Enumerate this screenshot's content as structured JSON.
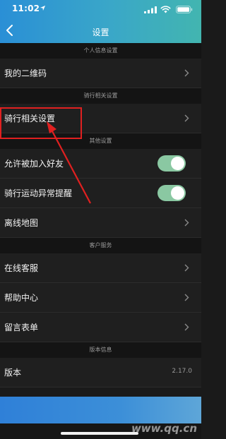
{
  "status_bar": {
    "time": "11:02"
  },
  "nav": {
    "title": "设置"
  },
  "sections": [
    {
      "header": "个人信息设置",
      "rows": [
        {
          "label": "我的二维码",
          "control": "chevron"
        }
      ]
    },
    {
      "header": "骑行相关设置",
      "rows": [
        {
          "label": "骑行相关设置",
          "control": "chevron"
        }
      ]
    },
    {
      "header": "其他设置",
      "rows": [
        {
          "label": "允许被加入好友",
          "control": "toggle",
          "on": true
        },
        {
          "label": "骑行运动异常提醒",
          "control": "toggle",
          "on": true
        },
        {
          "label": "离线地图",
          "control": "chevron"
        }
      ]
    },
    {
      "header": "客户服务",
      "rows": [
        {
          "label": "在线客服",
          "control": "chevron"
        },
        {
          "label": "帮助中心",
          "control": "chevron"
        },
        {
          "label": "留言表单",
          "control": "chevron"
        }
      ]
    },
    {
      "header": "版本信息",
      "rows": [
        {
          "label": "版本",
          "control": "value",
          "value": "2.17.0"
        }
      ]
    }
  ],
  "watermark": "www.qq.cn",
  "colors": {
    "accent_toggle": "#8ac8a2",
    "highlight": "#e02020",
    "header_gradient_start": "#2a8fd6",
    "header_gradient_end": "#42b5b0"
  },
  "icons": [
    "location-arrow-icon",
    "cellular-signal-icon",
    "wifi-icon",
    "battery-icon",
    "back-chevron-icon",
    "chevron-right-icon"
  ]
}
